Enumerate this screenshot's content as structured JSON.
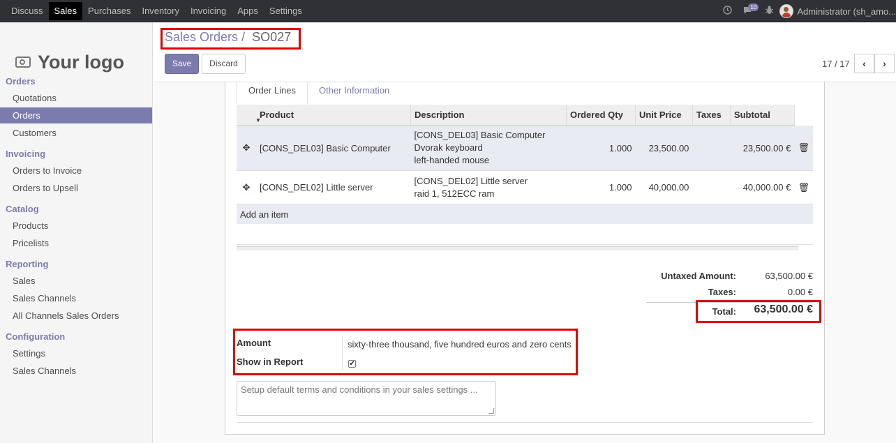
{
  "topbar": {
    "menu": [
      "Discuss",
      "Sales",
      "Purchases",
      "Inventory",
      "Invoicing",
      "Apps",
      "Settings"
    ],
    "active": "Sales",
    "icons": [
      "clock-icon",
      "chat-icon",
      "bug-icon"
    ],
    "chat_count": "10",
    "user": "Administrator (sh_amo..."
  },
  "sidebar": {
    "logo_text": "Your logo",
    "sections": [
      {
        "title": "Orders",
        "items": [
          "Quotations",
          "Orders",
          "Customers"
        ]
      },
      {
        "title": "Invoicing",
        "items": [
          "Orders to Invoice",
          "Orders to Upsell"
        ]
      },
      {
        "title": "Catalog",
        "items": [
          "Products",
          "Pricelists"
        ]
      },
      {
        "title": "Reporting",
        "items": [
          "Sales",
          "Sales Channels",
          "All Channels Sales Orders"
        ]
      },
      {
        "title": "Configuration",
        "items": [
          "Settings",
          "Sales Channels"
        ]
      }
    ],
    "active_item": "Orders"
  },
  "control_panel": {
    "breadcrumb_parent": "Sales Orders",
    "breadcrumb_sep": "/",
    "breadcrumb_current": "SO027",
    "save_label": "Save",
    "discard_label": "Discard",
    "pager": "17 / 17"
  },
  "tabs": {
    "order_lines": "Order Lines",
    "other_info": "Other Information"
  },
  "lines": {
    "headers": {
      "product": "Product",
      "description": "Description",
      "qty": "Ordered Qty",
      "price": "Unit Price",
      "taxes": "Taxes",
      "subtotal": "Subtotal"
    },
    "rows": [
      {
        "product": "[CONS_DEL03] Basic Computer",
        "desc": [
          "[CONS_DEL03] Basic Computer",
          "Dvorak keyboard",
          "left-handed mouse"
        ],
        "qty": "1.000",
        "price": "23,500.00",
        "taxes": "",
        "subtotal": "23,500.00 €"
      },
      {
        "product": "[CONS_DEL02] Little server",
        "desc": [
          "[CONS_DEL02] Little server",
          "raid 1, 512ECC ram"
        ],
        "qty": "1.000",
        "price": "40,000.00",
        "taxes": "",
        "subtotal": "40,000.00 €"
      }
    ],
    "add_item": "Add an item"
  },
  "totals": {
    "untaxed_label": "Untaxed Amount:",
    "untaxed": "63,500.00 €",
    "taxes_label": "Taxes:",
    "taxes": "0.00 €",
    "total_label": "Total:",
    "total": "63,500.00 €"
  },
  "amount_words": {
    "amount_label": "Amount",
    "amount_value": "sixty-three thousand, five hundred euros and zero cents",
    "show_label": "Show in Report",
    "show_checked": true
  },
  "notes_placeholder": "Setup default terms and conditions in your sales settings ...",
  "colors": {
    "brand": "#7c7bad",
    "highlight": "#e00000",
    "topbar": "#2f3136"
  }
}
